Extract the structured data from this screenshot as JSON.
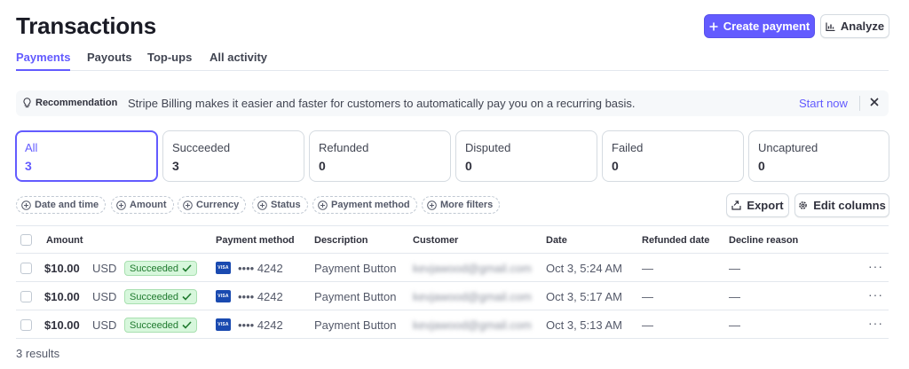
{
  "page": {
    "title": "Transactions"
  },
  "header": {
    "create_label": "Create payment",
    "analyze_label": "Analyze"
  },
  "tabs": [
    {
      "label": "Payments",
      "active": true
    },
    {
      "label": "Payouts"
    },
    {
      "label": "Top-ups"
    },
    {
      "label": "All activity"
    }
  ],
  "banner": {
    "label": "Recommendation",
    "text": "Stripe Billing makes it easier and faster for customers to automatically pay you on a recurring basis.",
    "action": "Start now"
  },
  "status_cards": [
    {
      "label": "All",
      "count": "3",
      "active": true
    },
    {
      "label": "Succeeded",
      "count": "3"
    },
    {
      "label": "Refunded",
      "count": "0"
    },
    {
      "label": "Disputed",
      "count": "0"
    },
    {
      "label": "Failed",
      "count": "0"
    },
    {
      "label": "Uncaptured",
      "count": "0"
    }
  ],
  "filters": [
    "Date and time",
    "Amount",
    "Currency",
    "Status",
    "Payment method",
    "More filters"
  ],
  "toolbar": {
    "export_label": "Export",
    "edit_columns_label": "Edit columns"
  },
  "table": {
    "columns": [
      "Amount",
      "Payment method",
      "Description",
      "Customer",
      "Date",
      "Refunded date",
      "Decline reason"
    ],
    "rows": [
      {
        "amount": "$10.00",
        "currency": "USD",
        "status": "Succeeded",
        "card_brand": "VISA",
        "card": "•••• 4242",
        "description": "Payment Button",
        "customer": "kevjawood@gmail.com",
        "date": "Oct 3, 5:24 AM",
        "refunded": "—",
        "decline": "—"
      },
      {
        "amount": "$10.00",
        "currency": "USD",
        "status": "Succeeded",
        "card_brand": "VISA",
        "card": "•••• 4242",
        "description": "Payment Button",
        "customer": "kevjawood@gmail.com",
        "date": "Oct 3, 5:17 AM",
        "refunded": "—",
        "decline": "—"
      },
      {
        "amount": "$10.00",
        "currency": "USD",
        "status": "Succeeded",
        "card_brand": "VISA",
        "card": "•••• 4242",
        "description": "Payment Button",
        "customer": "kevjawood@gmail.com",
        "date": "Oct 3, 5:13 AM",
        "refunded": "—",
        "decline": "—"
      }
    ]
  },
  "footer": {
    "results": "3 results"
  },
  "colors": {
    "accent": "#635bff",
    "success_bg": "#d7f7dc",
    "success_text": "#1f7a2e",
    "visa": "#1a4ab0"
  }
}
